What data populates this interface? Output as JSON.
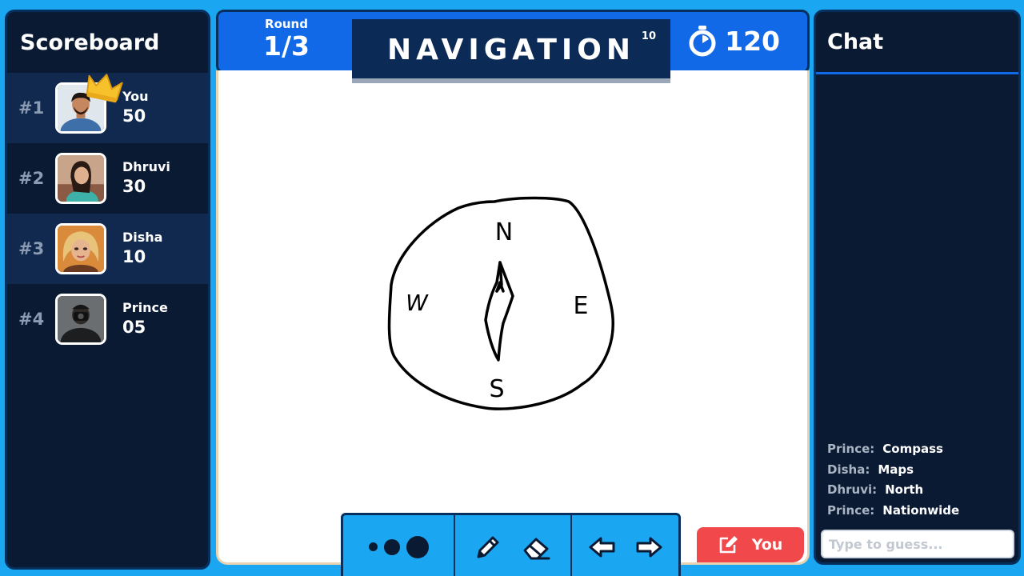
{
  "scoreboard": {
    "title": "Scoreboard",
    "players": [
      {
        "rank": "#1",
        "name": "You",
        "score": "50",
        "crown": true
      },
      {
        "rank": "#2",
        "name": "Dhruvi",
        "score": "30"
      },
      {
        "rank": "#3",
        "name": "Disha",
        "score": "10"
      },
      {
        "rank": "#4",
        "name": "Prince",
        "score": "05"
      }
    ]
  },
  "header": {
    "round_label": "Round",
    "round_value": "1/3",
    "word": "NAVIGATION",
    "word_length": "10",
    "timer": "120",
    "timer_icon": "stopwatch-icon"
  },
  "canvas": {
    "letters": {
      "north": "N",
      "east": "E",
      "south": "S",
      "west": "W"
    }
  },
  "toolbar": {
    "brush_sizes": [
      "small",
      "medium",
      "large"
    ],
    "tools": [
      "pencil-icon",
      "eraser-icon"
    ],
    "history": [
      "undo-arrow-icon",
      "redo-arrow-icon"
    ]
  },
  "drawer": {
    "label": "You",
    "icon": "edit-icon"
  },
  "chat": {
    "title": "Chat",
    "messages": [
      {
        "sender": "Prince:",
        "text": "Compass"
      },
      {
        "sender": "Disha:",
        "text": "Maps"
      },
      {
        "sender": "Dhruvi:",
        "text": "North"
      },
      {
        "sender": "Prince:",
        "text": "Nationwide"
      }
    ],
    "input_placeholder": "Type to guess..."
  },
  "colors": {
    "background": "#1aa6f0",
    "panel": "#0b1a33",
    "accent_blue": "#1169e8",
    "drawer_badge": "#f0484b",
    "crown": "#f7c12b"
  }
}
